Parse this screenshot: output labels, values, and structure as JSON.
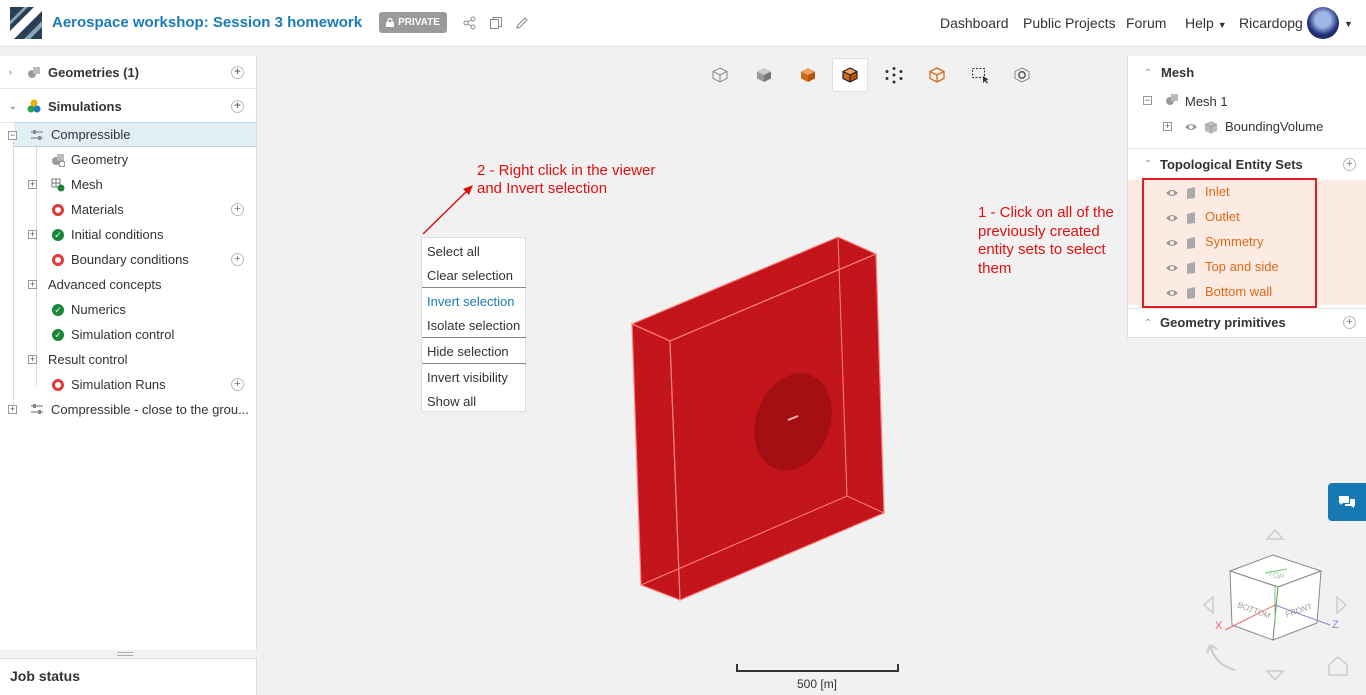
{
  "header": {
    "title": "Aerospace workshop: Session 3 homework",
    "badge": "PRIVATE",
    "nav": [
      "Dashboard",
      "Public Projects",
      "Forum",
      "Help"
    ],
    "user": "Ricardopg"
  },
  "tree": {
    "geometries": "Geometries (1)",
    "simulations": "Simulations",
    "compressible": "Compressible",
    "geometry": "Geometry",
    "mesh": "Mesh",
    "materials": "Materials",
    "initial_conditions": "Initial conditions",
    "boundary_conditions": "Boundary conditions",
    "advanced_concepts": "Advanced concepts",
    "numerics": "Numerics",
    "simulation_control": "Simulation control",
    "result_control": "Result control",
    "simulation_runs": "Simulation Runs",
    "compressible2": "Compressible - close to the grou..."
  },
  "job_status": "Job status",
  "context_menu": {
    "select_all": "Select all",
    "clear_selection": "Clear selection",
    "invert_selection": "Invert selection",
    "isolate_selection": "Isolate selection",
    "hide_selection": "Hide selection",
    "invert_visibility": "Invert visibility",
    "show_all": "Show all"
  },
  "annotations": {
    "step2_line1": "2 - Right click in the viewer",
    "step2_line2": "and Invert selection",
    "step1_line1": "1 - Click on all of the",
    "step1_line2": "previously created",
    "step1_line3": "entity sets to select",
    "step1_line4": "them"
  },
  "right_panel": {
    "mesh_header": "Mesh",
    "mesh1": "Mesh 1",
    "bounding_volume": "BoundingVolume",
    "topo_header": "Topological Entity Sets",
    "sets": [
      "Inlet",
      "Outlet",
      "Symmetry",
      "Top and side",
      "Bottom wall"
    ],
    "geo_primitives": "Geometry primitives"
  },
  "viewer": {
    "scale_label": "500 [m]",
    "cube_labels": {
      "top": "TOP",
      "bottom": "BOTTOM",
      "front": "FRONT",
      "x": "X",
      "z": "Z"
    }
  },
  "colors": {
    "accent": "#1b7bb8",
    "annotation": "#e01010",
    "entity_set_text": "#e06a1a",
    "selected_mesh": "#c8171c"
  }
}
